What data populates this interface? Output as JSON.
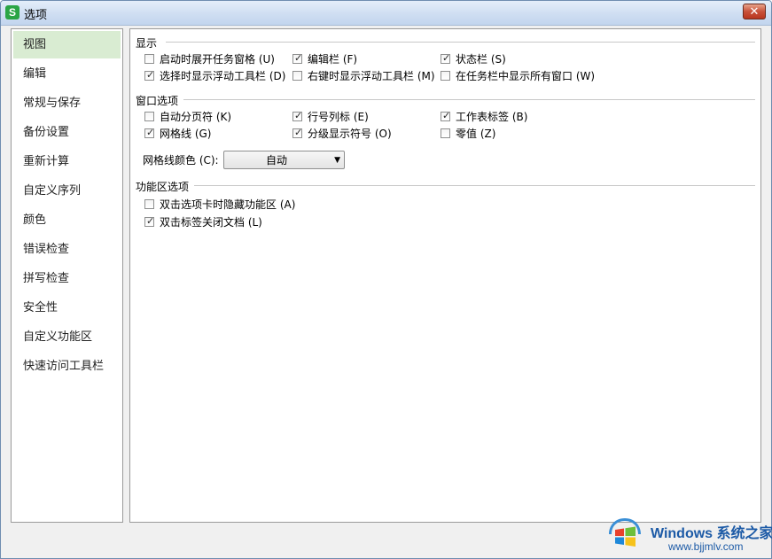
{
  "window": {
    "title": "选项",
    "app_icon_letter": "S",
    "close_glyph": "✕"
  },
  "sidebar": {
    "items": [
      {
        "label": "视图",
        "active": true
      },
      {
        "label": "编辑"
      },
      {
        "label": "常规与保存"
      },
      {
        "label": "备份设置"
      },
      {
        "label": "重新计算"
      },
      {
        "label": "自定义序列"
      },
      {
        "label": "颜色"
      },
      {
        "label": "错误检查"
      },
      {
        "label": "拼写检查"
      },
      {
        "label": "安全性"
      },
      {
        "label": "自定义功能区"
      },
      {
        "label": "快速访问工具栏"
      }
    ]
  },
  "display": {
    "title": "显示",
    "options": [
      {
        "label": "启动时展开任务窗格 (U)",
        "checked": false
      },
      {
        "label": "编辑栏 (F)",
        "checked": true
      },
      {
        "label": "状态栏 (S)",
        "checked": true
      },
      {
        "label": "选择时显示浮动工具栏 (D)",
        "checked": true
      },
      {
        "label": "右键时显示浮动工具栏 (M)",
        "checked": false
      },
      {
        "label": "在任务栏中显示所有窗口 (W)",
        "checked": false
      }
    ]
  },
  "window_options": {
    "title": "窗口选项",
    "options": [
      {
        "label": "自动分页符 (K)",
        "checked": false
      },
      {
        "label": "行号列标 (E)",
        "checked": true
      },
      {
        "label": "工作表标签 (B)",
        "checked": true
      },
      {
        "label": "网格线 (G)",
        "checked": true
      },
      {
        "label": "分级显示符号 (O)",
        "checked": true
      },
      {
        "label": "零值 (Z)",
        "checked": false
      }
    ],
    "grid_color_label": "网格线颜色 (C):",
    "grid_color_value": "自动",
    "dropdown_arrow": "▼"
  },
  "ribbon": {
    "title": "功能区选项",
    "options": [
      {
        "label": "双击选项卡时隐藏功能区 (A)",
        "checked": false
      },
      {
        "label": "双击标签关闭文档 (L)",
        "checked": true
      }
    ]
  },
  "watermark": {
    "title": "Windows 系统之家",
    "url": "www.bjjmlv.com"
  },
  "checkmark_glyph": "✓",
  "colors": {
    "active_sidebar_bg": "#d9ecd2",
    "app_icon": "#2aa545",
    "close_button": "#c8513a",
    "watermark_blue": "#1c5aa6"
  }
}
